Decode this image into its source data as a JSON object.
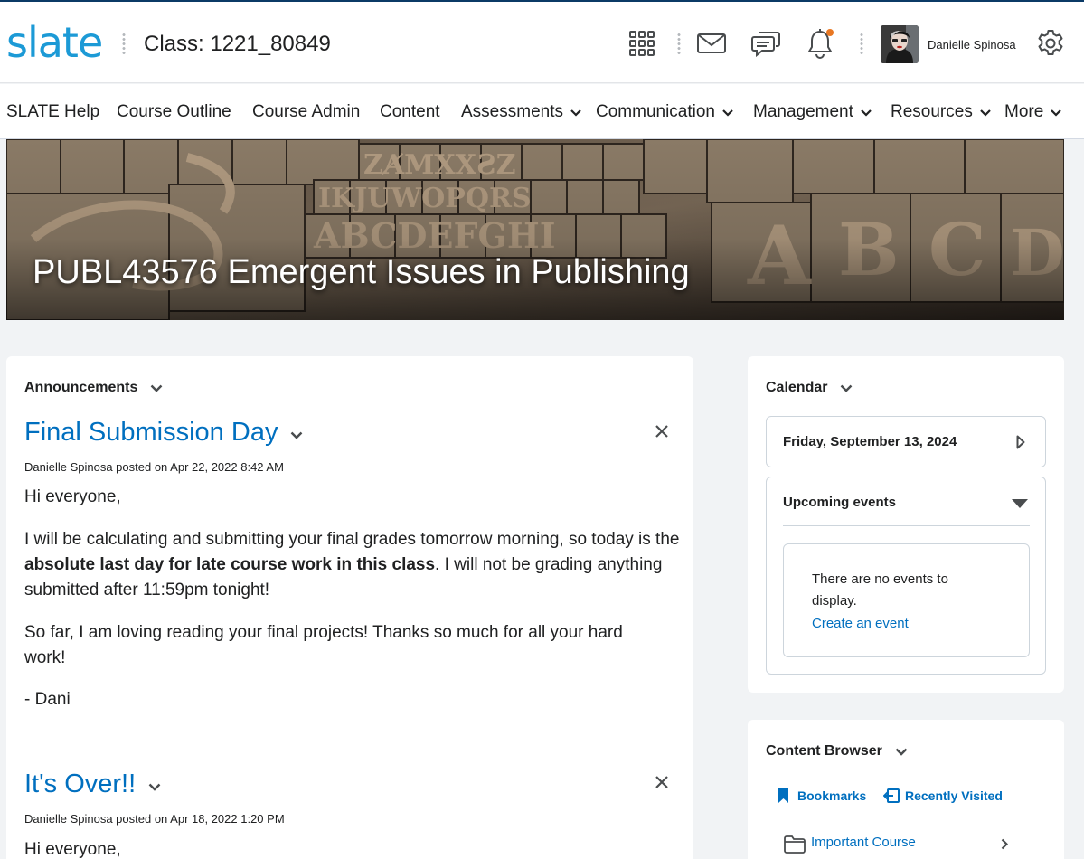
{
  "header": {
    "logo": "slate",
    "class_title": "Class: 1221_80849",
    "user_name": "Danielle Spinosa",
    "notification_dot_color": "#e87722"
  },
  "nav": {
    "items": [
      {
        "label": "SLATE Help",
        "dropdown": false
      },
      {
        "label": "Course Outline",
        "dropdown": false
      },
      {
        "label": "Course Admin",
        "dropdown": false
      },
      {
        "label": "Content",
        "dropdown": false
      },
      {
        "label": "Assessments",
        "dropdown": true
      },
      {
        "label": "Communication",
        "dropdown": true
      },
      {
        "label": "Management",
        "dropdown": true
      },
      {
        "label": "Resources",
        "dropdown": true
      },
      {
        "label": "More",
        "dropdown": true
      }
    ]
  },
  "banner": {
    "course_title": "PUBL43576 Emergent Issues in Publishing"
  },
  "announcements": {
    "heading": "Announcements",
    "items": [
      {
        "title": "Final Submission Day",
        "meta": "Danielle Spinosa posted on Apr 22, 2022 8:42 AM",
        "greeting": "Hi everyone,",
        "p2_before": "I will be calculating and submitting your final grades tomorrow morning, so today is the ",
        "p2_bold": "absolute last day for late course work in this class",
        "p2_after": ". I will not be grading anything submitted after 11:59pm tonight!",
        "p3": "So far, I am loving reading your final projects! Thanks so much for all your hard work!",
        "signoff": "- Dani"
      },
      {
        "title": "It's Over!!",
        "meta": "Danielle Spinosa posted on Apr 18, 2022 1:20 PM",
        "greeting": "Hi everyone,"
      }
    ]
  },
  "calendar": {
    "heading": "Calendar",
    "date": "Friday, September 13, 2024",
    "upcoming_heading": "Upcoming events",
    "empty_text": "There are no events to display.",
    "create_link": "Create an event"
  },
  "content_browser": {
    "heading": "Content Browser",
    "bookmarks_label": "Bookmarks",
    "recent_label": "Recently Visited",
    "item_label": "Important Course"
  },
  "colors": {
    "link": "#006fbf",
    "logo": "#1c9ad6",
    "top_border": "#0b3a66"
  }
}
